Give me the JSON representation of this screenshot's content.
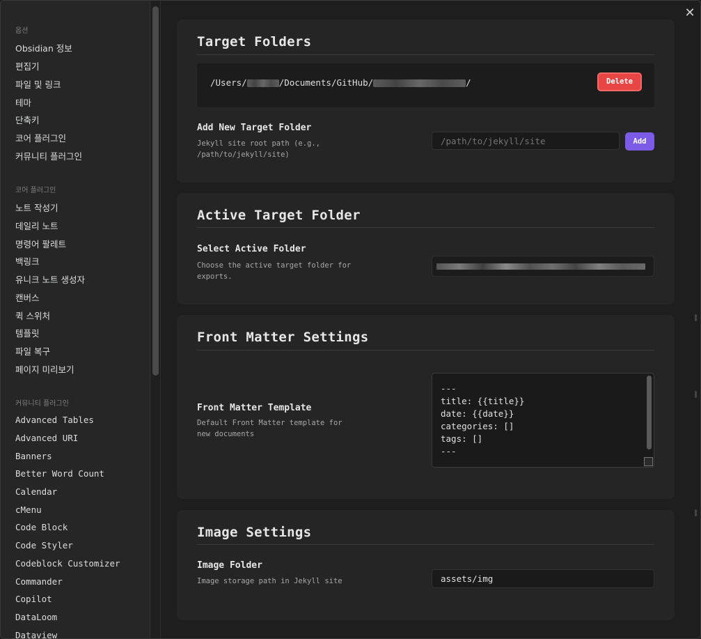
{
  "sidebar": {
    "sections": [
      {
        "title": "옵션",
        "items": [
          "Obsidian 정보",
          "편집기",
          "파일 및 링크",
          "테마",
          "단축키",
          "코어 플러그인",
          "커뮤니티 플러그인"
        ]
      },
      {
        "title": "코어 플러그인",
        "items": [
          "노트 작성기",
          "데일리 노트",
          "명령어 팔레트",
          "백링크",
          "유니크 노트 생성자",
          "캔버스",
          "퀵 스위처",
          "템플릿",
          "파일 복구",
          "페이지 미리보기"
        ]
      },
      {
        "title": "커뮤니티 플러그인",
        "items": [
          "Advanced Tables",
          "Advanced URI",
          "Banners",
          "Better Word Count",
          "Calendar",
          "cMenu",
          "Code Block",
          "Code Styler",
          "Codeblock Customizer",
          "Commander",
          "Copilot",
          "DataLoom",
          "Dataview"
        ]
      }
    ]
  },
  "close_icon": "close-icon",
  "target_folders": {
    "title": "Target Folders",
    "folder_path": {
      "prefix": "/Users/",
      "middle": "/Documents/GitHub/",
      "suffix": "/"
    },
    "delete_label": "Delete",
    "add_new": {
      "label": "Add New Target Folder",
      "description": "Jekyll site root path (e.g., /path/to/jekyll/site)",
      "placeholder": "/path/to/jekyll/site",
      "add_label": "Add"
    }
  },
  "active_target": {
    "title": "Active Target Folder",
    "select_label": "Select Active Folder",
    "select_description": "Choose the active target folder for exports."
  },
  "front_matter": {
    "title": "Front Matter Settings",
    "template_label": "Front Matter Template",
    "template_description": "Default Front Matter template for new documents",
    "template_lines": [
      "---",
      "title: {{title}}",
      "date: {{date}}",
      "categories: []",
      "tags: []",
      "---"
    ]
  },
  "image_settings": {
    "title": "Image Settings",
    "folder_label": "Image Folder",
    "folder_description": "Image storage path in Jekyll site",
    "folder_value": "assets/img"
  },
  "colors": {
    "delete_button": "#e84545",
    "add_button": "#7c5ce6",
    "background": "#1e1e1e",
    "card": "#252525"
  }
}
